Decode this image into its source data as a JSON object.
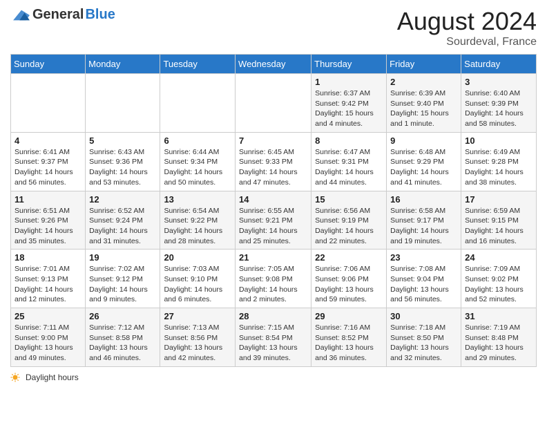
{
  "header": {
    "logo_general": "General",
    "logo_blue": "Blue",
    "month_year": "August 2024",
    "location": "Sourdeval, France"
  },
  "days_of_week": [
    "Sunday",
    "Monday",
    "Tuesday",
    "Wednesday",
    "Thursday",
    "Friday",
    "Saturday"
  ],
  "weeks": [
    [
      {
        "day": "",
        "detail": ""
      },
      {
        "day": "",
        "detail": ""
      },
      {
        "day": "",
        "detail": ""
      },
      {
        "day": "",
        "detail": ""
      },
      {
        "day": "1",
        "detail": "Sunrise: 6:37 AM\nSunset: 9:42 PM\nDaylight: 15 hours\nand 4 minutes."
      },
      {
        "day": "2",
        "detail": "Sunrise: 6:39 AM\nSunset: 9:40 PM\nDaylight: 15 hours\nand 1 minute."
      },
      {
        "day": "3",
        "detail": "Sunrise: 6:40 AM\nSunset: 9:39 PM\nDaylight: 14 hours\nand 58 minutes."
      }
    ],
    [
      {
        "day": "4",
        "detail": "Sunrise: 6:41 AM\nSunset: 9:37 PM\nDaylight: 14 hours\nand 56 minutes."
      },
      {
        "day": "5",
        "detail": "Sunrise: 6:43 AM\nSunset: 9:36 PM\nDaylight: 14 hours\nand 53 minutes."
      },
      {
        "day": "6",
        "detail": "Sunrise: 6:44 AM\nSunset: 9:34 PM\nDaylight: 14 hours\nand 50 minutes."
      },
      {
        "day": "7",
        "detail": "Sunrise: 6:45 AM\nSunset: 9:33 PM\nDaylight: 14 hours\nand 47 minutes."
      },
      {
        "day": "8",
        "detail": "Sunrise: 6:47 AM\nSunset: 9:31 PM\nDaylight: 14 hours\nand 44 minutes."
      },
      {
        "day": "9",
        "detail": "Sunrise: 6:48 AM\nSunset: 9:29 PM\nDaylight: 14 hours\nand 41 minutes."
      },
      {
        "day": "10",
        "detail": "Sunrise: 6:49 AM\nSunset: 9:28 PM\nDaylight: 14 hours\nand 38 minutes."
      }
    ],
    [
      {
        "day": "11",
        "detail": "Sunrise: 6:51 AM\nSunset: 9:26 PM\nDaylight: 14 hours\nand 35 minutes."
      },
      {
        "day": "12",
        "detail": "Sunrise: 6:52 AM\nSunset: 9:24 PM\nDaylight: 14 hours\nand 31 minutes."
      },
      {
        "day": "13",
        "detail": "Sunrise: 6:54 AM\nSunset: 9:22 PM\nDaylight: 14 hours\nand 28 minutes."
      },
      {
        "day": "14",
        "detail": "Sunrise: 6:55 AM\nSunset: 9:21 PM\nDaylight: 14 hours\nand 25 minutes."
      },
      {
        "day": "15",
        "detail": "Sunrise: 6:56 AM\nSunset: 9:19 PM\nDaylight: 14 hours\nand 22 minutes."
      },
      {
        "day": "16",
        "detail": "Sunrise: 6:58 AM\nSunset: 9:17 PM\nDaylight: 14 hours\nand 19 minutes."
      },
      {
        "day": "17",
        "detail": "Sunrise: 6:59 AM\nSunset: 9:15 PM\nDaylight: 14 hours\nand 16 minutes."
      }
    ],
    [
      {
        "day": "18",
        "detail": "Sunrise: 7:01 AM\nSunset: 9:13 PM\nDaylight: 14 hours\nand 12 minutes."
      },
      {
        "day": "19",
        "detail": "Sunrise: 7:02 AM\nSunset: 9:12 PM\nDaylight: 14 hours\nand 9 minutes."
      },
      {
        "day": "20",
        "detail": "Sunrise: 7:03 AM\nSunset: 9:10 PM\nDaylight: 14 hours\nand 6 minutes."
      },
      {
        "day": "21",
        "detail": "Sunrise: 7:05 AM\nSunset: 9:08 PM\nDaylight: 14 hours\nand 2 minutes."
      },
      {
        "day": "22",
        "detail": "Sunrise: 7:06 AM\nSunset: 9:06 PM\nDaylight: 13 hours\nand 59 minutes."
      },
      {
        "day": "23",
        "detail": "Sunrise: 7:08 AM\nSunset: 9:04 PM\nDaylight: 13 hours\nand 56 minutes."
      },
      {
        "day": "24",
        "detail": "Sunrise: 7:09 AM\nSunset: 9:02 PM\nDaylight: 13 hours\nand 52 minutes."
      }
    ],
    [
      {
        "day": "25",
        "detail": "Sunrise: 7:11 AM\nSunset: 9:00 PM\nDaylight: 13 hours\nand 49 minutes."
      },
      {
        "day": "26",
        "detail": "Sunrise: 7:12 AM\nSunset: 8:58 PM\nDaylight: 13 hours\nand 46 minutes."
      },
      {
        "day": "27",
        "detail": "Sunrise: 7:13 AM\nSunset: 8:56 PM\nDaylight: 13 hours\nand 42 minutes."
      },
      {
        "day": "28",
        "detail": "Sunrise: 7:15 AM\nSunset: 8:54 PM\nDaylight: 13 hours\nand 39 minutes."
      },
      {
        "day": "29",
        "detail": "Sunrise: 7:16 AM\nSunset: 8:52 PM\nDaylight: 13 hours\nand 36 minutes."
      },
      {
        "day": "30",
        "detail": "Sunrise: 7:18 AM\nSunset: 8:50 PM\nDaylight: 13 hours\nand 32 minutes."
      },
      {
        "day": "31",
        "detail": "Sunrise: 7:19 AM\nSunset: 8:48 PM\nDaylight: 13 hours\nand 29 minutes."
      }
    ]
  ],
  "legend": {
    "daylight_label": "Daylight hours"
  }
}
